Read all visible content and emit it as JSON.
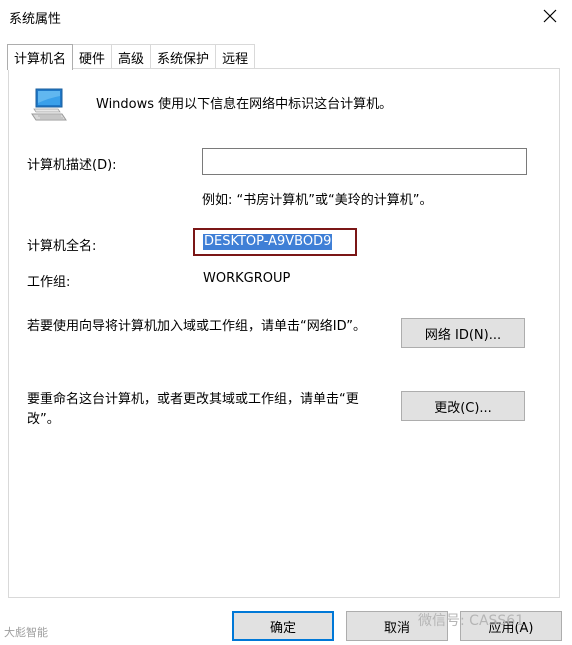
{
  "window": {
    "title": "系统属性"
  },
  "tabs": [
    {
      "label": "计算机名",
      "active": true
    },
    {
      "label": "硬件"
    },
    {
      "label": "高级"
    },
    {
      "label": "系统保护"
    },
    {
      "label": "远程"
    }
  ],
  "intro_text": "Windows 使用以下信息在网络中标识这台计算机。",
  "description": {
    "label": "计算机描述(D):",
    "value": "",
    "example": "例如: “书房计算机”或“美玲的计算机”。"
  },
  "full_name": {
    "label": "计算机全名:",
    "value": "DESKTOP-A9VBOD9"
  },
  "workgroup": {
    "label": "工作组:",
    "value": "WORKGROUP"
  },
  "network_id": {
    "text": "若要使用向导将计算机加入域或工作组，请单击“网络ID”。",
    "button": "网络 ID(N)..."
  },
  "change": {
    "text": "要重命名这台计算机，或者更改其域或工作组，请单击“更改”。",
    "button": "更改(C)..."
  },
  "footer": {
    "ok": "确定",
    "cancel": "取消",
    "apply": "应用(A)"
  },
  "watermarks": {
    "left": "大彪智能",
    "right": "微信号: CASS61"
  },
  "colors": {
    "selection": "#3f7fd6",
    "highlight_border": "#7b1616"
  }
}
